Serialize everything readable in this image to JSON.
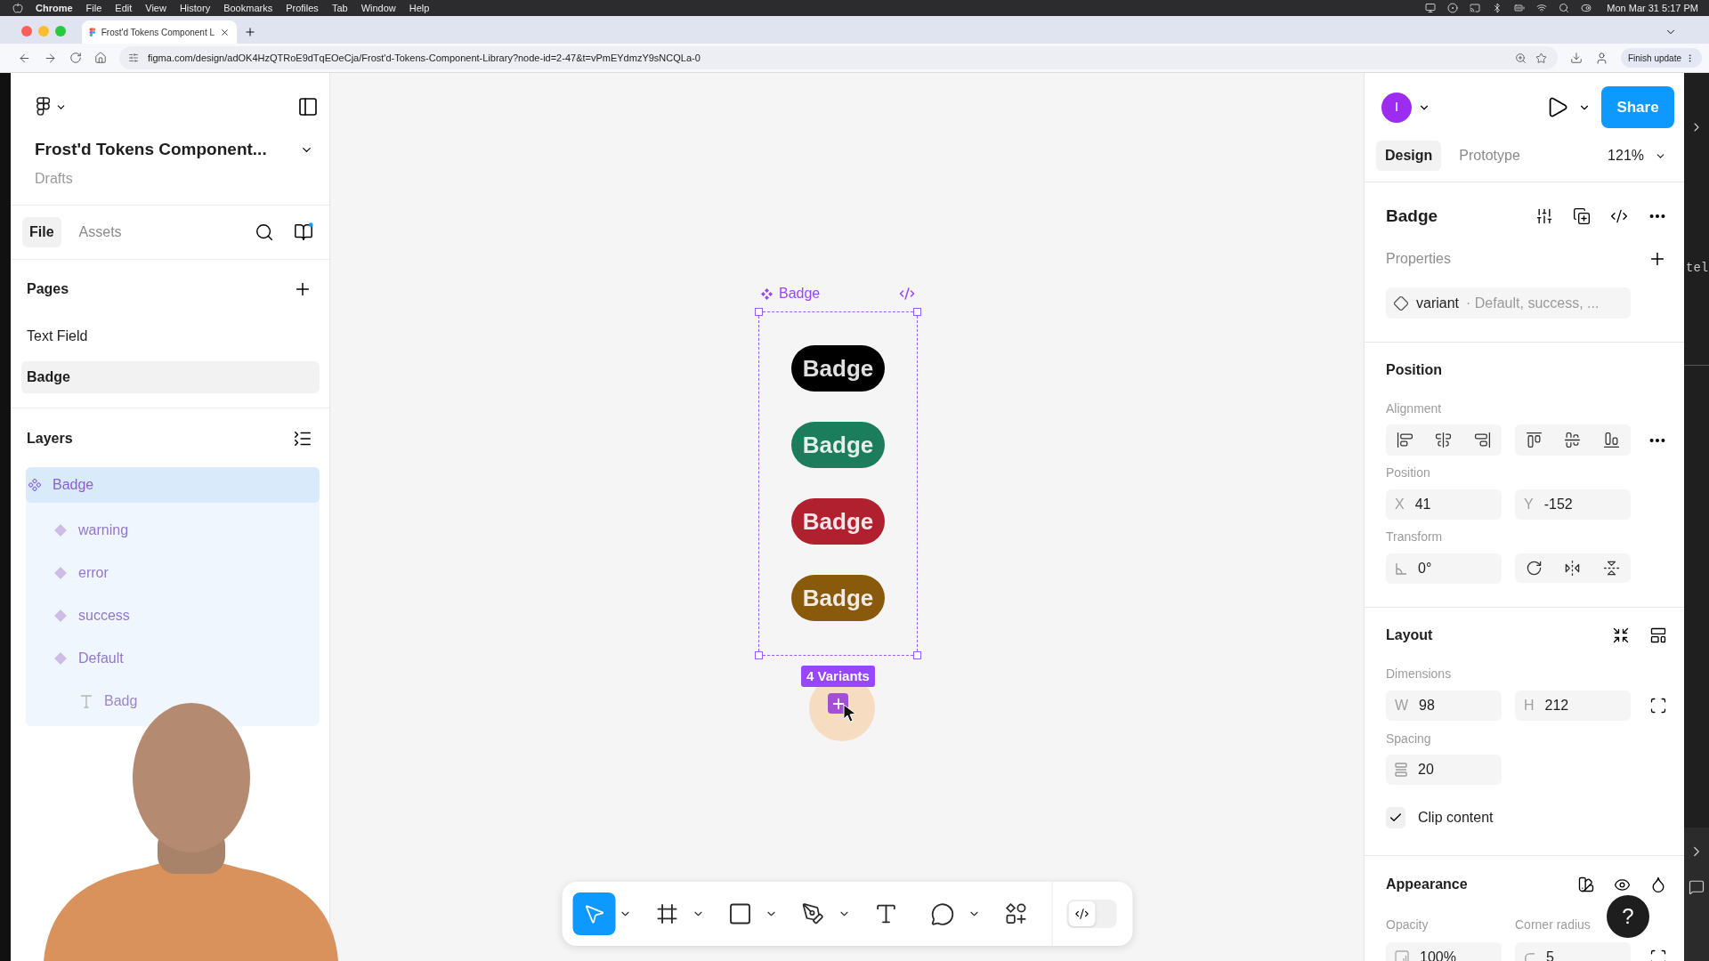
{
  "menu_bar": {
    "app": "Chrome",
    "menus": [
      "File",
      "Edit",
      "View",
      "History",
      "Bookmarks",
      "Profiles",
      "Tab",
      "Window",
      "Help"
    ],
    "clock": "Mon Mar 31 5:17 PM"
  },
  "browser": {
    "tab_title": "Frost'd Tokens Component L",
    "url": "figma.com/design/adOK4HzQTRoE9dTqEOeCja/Frost'd-Tokens-Component-Library?node-id=2-47&t=vPmEYdmzY9sNCQLa-0",
    "update_button": "Finish update"
  },
  "left_panel": {
    "file_name": "Frost'd Tokens Component...",
    "location": "Drafts",
    "tabs": [
      {
        "label": "File",
        "selected": true
      },
      {
        "label": "Assets",
        "selected": false
      }
    ],
    "pages_title": "Pages",
    "pages": [
      {
        "label": "Text Field",
        "selected": false
      },
      {
        "label": "Badge",
        "selected": true
      }
    ],
    "layers_title": "Layers",
    "layers": [
      {
        "kind": "component_set",
        "label": "Badge",
        "selected": true,
        "children": [
          {
            "kind": "variant",
            "label": "warning",
            "selected": false
          },
          {
            "kind": "variant",
            "label": "error",
            "selected": false
          },
          {
            "kind": "variant",
            "label": "success",
            "selected": false
          },
          {
            "kind": "variant",
            "label": "Default",
            "selected": false,
            "children": [
              {
                "kind": "text",
                "label": "Badg",
                "selected": false
              }
            ]
          }
        ]
      }
    ]
  },
  "canvas": {
    "frame_label": "Badge",
    "badges": [
      {
        "text": "Badge",
        "color": "#000000"
      },
      {
        "text": "Badge",
        "color": "#1c7d5c"
      },
      {
        "text": "Badge",
        "color": "#b1202f"
      },
      {
        "text": "Badge",
        "color": "#8a5a0c"
      }
    ],
    "variants_tag": "4 Variants",
    "toolbar": {
      "tools": [
        {
          "kind": "move",
          "selected": true,
          "menu": true
        },
        {
          "kind": "frame",
          "selected": false,
          "menu": true
        },
        {
          "kind": "rectangle",
          "selected": false,
          "menu": true
        },
        {
          "kind": "pen",
          "selected": false,
          "menu": true
        },
        {
          "kind": "text",
          "selected": false,
          "menu": false
        },
        {
          "kind": "comment",
          "selected": false,
          "menu": true
        },
        {
          "kind": "actions",
          "selected": false,
          "menu": false
        }
      ],
      "dev_mode": false
    }
  },
  "right_panel": {
    "avatar_initial": "I",
    "share_button": "Share",
    "tabs": [
      {
        "label": "Design",
        "selected": true
      },
      {
        "label": "Prototype",
        "selected": false
      }
    ],
    "zoom": "121%",
    "selection_name": "Badge",
    "properties_title": "Properties",
    "properties": [
      {
        "name": "variant",
        "values": "· Default, success, ..."
      }
    ],
    "position": {
      "title": "Position",
      "alignment_label": "Alignment",
      "position_label": "Position",
      "x": {
        "label": "X",
        "value": "41"
      },
      "y": {
        "label": "Y",
        "value": "-152"
      },
      "transform_label": "Transform",
      "rotation": "0°"
    },
    "layout": {
      "title": "Layout",
      "dimensions_label": "Dimensions",
      "width": {
        "label": "W",
        "value": "98"
      },
      "height": {
        "label": "H",
        "value": "212"
      },
      "spacing_label": "Spacing",
      "spacing": "20",
      "clip_content": {
        "label": "Clip content",
        "checked": true
      }
    },
    "appearance": {
      "title": "Appearance",
      "opacity_label": "Opacity",
      "opacity": "100%",
      "corner_radius_label": "Corner radius",
      "corner_radius": "5"
    },
    "help_button": "?"
  },
  "side_window": {
    "text": "tel"
  }
}
